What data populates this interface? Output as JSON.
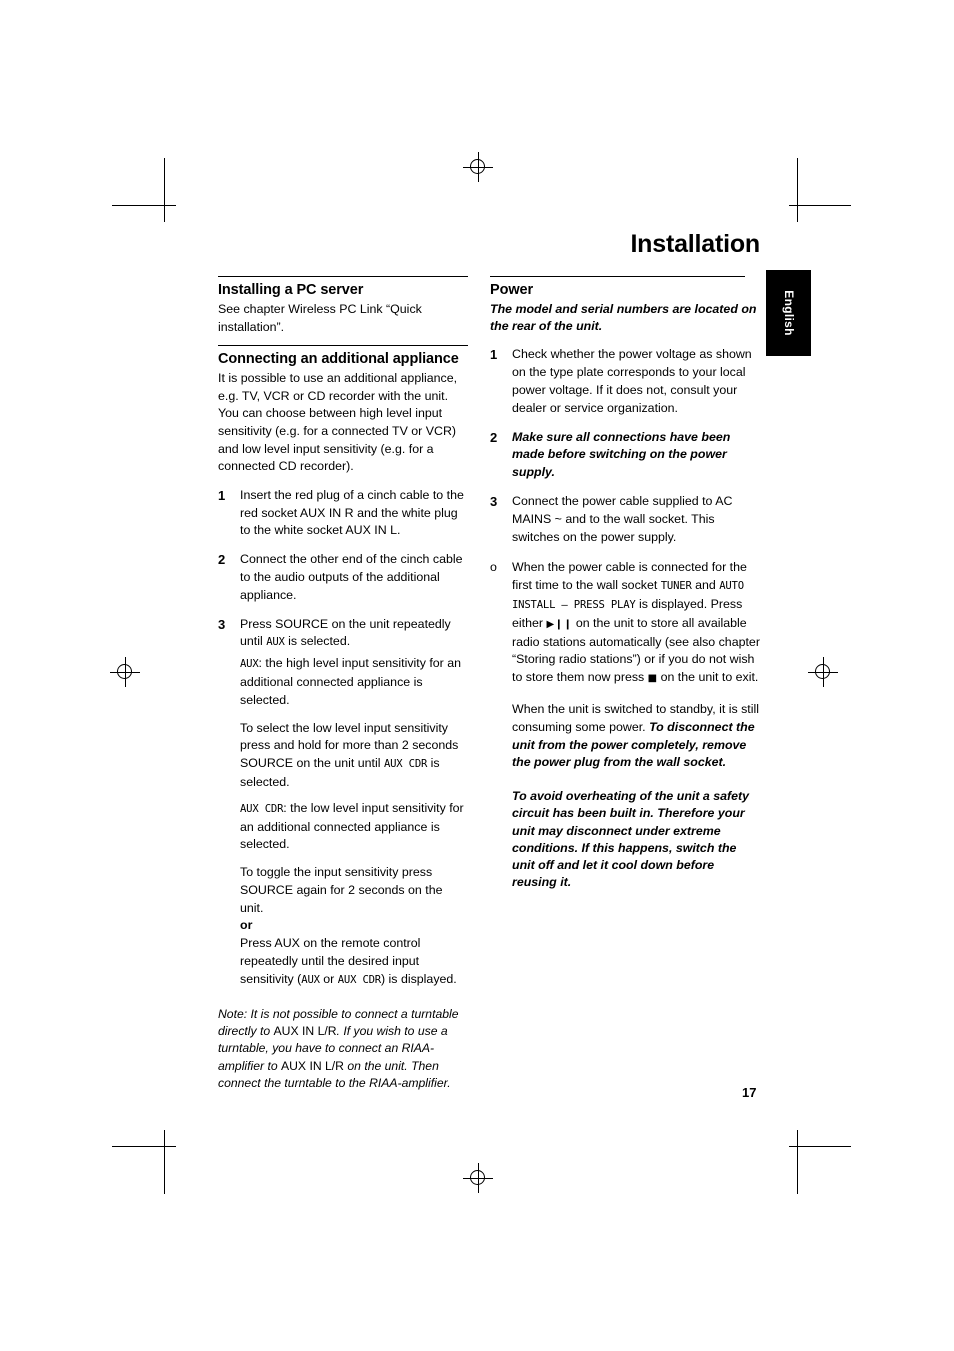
{
  "header": {
    "title": "Installation",
    "language_tab": "English",
    "page_number": "17"
  },
  "left": {
    "sections": [
      {
        "heading": "Installing a PC server",
        "body": "See chapter Wireless PC Link “Quick installation”."
      },
      {
        "heading": "Connecting an additional appliance",
        "body": "It is possible to use an additional appliance, e.g. TV, VCR or CD recorder with the unit. You can choose between high level input sensitivity (e.g. for a connected TV or VCR) and low level input sensitivity (e.g. for a connected CD recorder)."
      }
    ],
    "steps": [
      {
        "num": "1",
        "text": "Insert the red plug of a cinch cable to the red socket AUX IN R and the white plug to the white socket AUX IN L."
      },
      {
        "num": "2",
        "text": "Connect the other end of the cinch cable to the audio outputs of the additional appliance."
      },
      {
        "num": "3",
        "text": "Press SOURCE on the unit repeatedly until "
      }
    ],
    "step3": {
      "mono1": "AUX",
      "after_mono1": " is selected.",
      "sub1_mono": "AUX",
      "sub1_text": ": the high level input sensitivity for an additional connected appliance is selected.",
      "para1_a": "To select the low level input sensitivity press and hold for more than 2 seconds SOURCE on the unit until ",
      "para1_mono": "AUX CDR",
      "para1_b": " is selected.",
      "sub2_mono": "AUX CDR",
      "sub2_text": ": the low level input sensitivity for an additional connected appliance is selected.",
      "para2": "To toggle the input sensitivity press SOURCE again for 2 seconds on the unit.",
      "or": "or",
      "para3_a": "Press AUX on the remote control repeatedly until the desired input sensitivity (",
      "para3_mono1": "AUX",
      "para3_mid": " or ",
      "para3_mono2": "AUX CDR",
      "para3_b": ") is displayed."
    },
    "note": {
      "a": "Note: It is not possible to connect a turntable directly to ",
      "roman1": "AUX IN L/R",
      "b": ". If you wish to use a turntable, you have to connect an RIAA-amplifier to ",
      "roman2": "AUX IN L/R",
      "c": " on the unit. Then connect the turntable to the RIAA-amplifier."
    }
  },
  "right": {
    "heading": "Power",
    "subheading": "The model and serial numbers are located on the rear of the unit.",
    "steps": [
      {
        "num": "1",
        "text": "Check whether the power voltage as shown on the type plate corresponds to your local power voltage. If it does not, consult your dealer or service organization.",
        "style": "normal"
      },
      {
        "num": "2",
        "text": "Make sure all connections have been made before switching on the power supply.",
        "style": "bold-italic"
      },
      {
        "num": "3",
        "text": "Connect the power cable supplied to AC MAINS ~ and to the wall socket. This switches on the power supply.",
        "style": "normal"
      }
    ],
    "bullet": {
      "num": "o",
      "a": "When the power cable is connected for the first time to the wall socket ",
      "mono1": "TUNER",
      "b": " and ",
      "mono2": "AUTO INSTALL – PRESS PLAY",
      "c": " is displayed. Press either ",
      "play_glyph": "▶❙❙",
      "d": " on the unit to store all available radio stations automatically (see also chapter “Storing radio stations”) or if you do not wish to store them now press ",
      "stop_glyph": "■",
      "e": " on the unit to exit."
    },
    "standby": {
      "a": "When the unit is switched to standby, it is still consuming some power. ",
      "bold": "To disconnect the unit from the power completely, remove the power plug from the wall socket."
    },
    "warning": "To avoid overheating of the unit a safety circuit has been built in. Therefore your unit may disconnect under extreme conditions. If this happens, switch the unit off and let it cool down before reusing it."
  }
}
